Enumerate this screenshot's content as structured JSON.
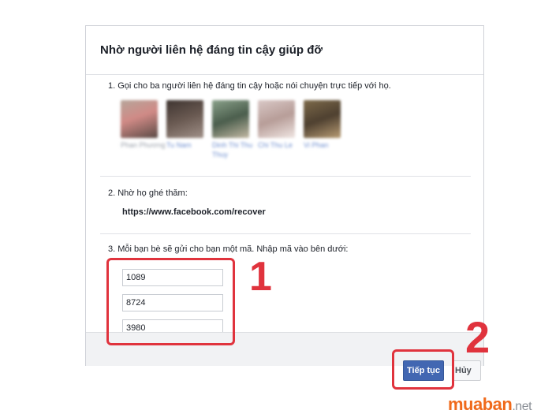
{
  "dialog": {
    "title": "Nhờ người liên hệ đáng tin cậy giúp đỡ",
    "step1": "1. Gọi cho ba người liên hệ đáng tin cậy hoặc nói chuyện trực tiếp với họ.",
    "contacts": [
      {
        "name": "Phan Phương",
        "photo_colors": [
          "#b6a59a",
          "#d08a86",
          "#5a4a45"
        ]
      },
      {
        "name": "Tu Nam",
        "photo_colors": [
          "#3e3430",
          "#6a5a52",
          "#a09088"
        ]
      },
      {
        "name": "Dinh Thi Thu Thuy",
        "photo_colors": [
          "#8aa18a",
          "#4b5e4d",
          "#c3b9a4"
        ]
      },
      {
        "name": "Chi Thu Le",
        "photo_colors": [
          "#d9c8c6",
          "#b79d98",
          "#f0e6e3"
        ]
      },
      {
        "name": "Vi Phan",
        "photo_colors": [
          "#7d6a4a",
          "#4e4030",
          "#b89c74"
        ]
      }
    ],
    "step2": "2. Nhờ họ ghé thăm:",
    "recover_url": "https://www.facebook.com/recover",
    "step3": "3. Mỗi bạn bè sẽ gửi cho bạn một mã. Nhập mã vào bên dưới:",
    "codes": [
      "1089",
      "8724",
      "3980"
    ],
    "continue_label": "Tiếp tục",
    "cancel_label": "Hủy"
  },
  "annotations": {
    "marker1": "1",
    "marker2": "2",
    "color": "#e0333d"
  },
  "watermark": {
    "main": "muaban",
    "tld": ".net"
  },
  "colors": {
    "primary_button": "#4267b2",
    "footer_bg": "#f1f2f4"
  }
}
